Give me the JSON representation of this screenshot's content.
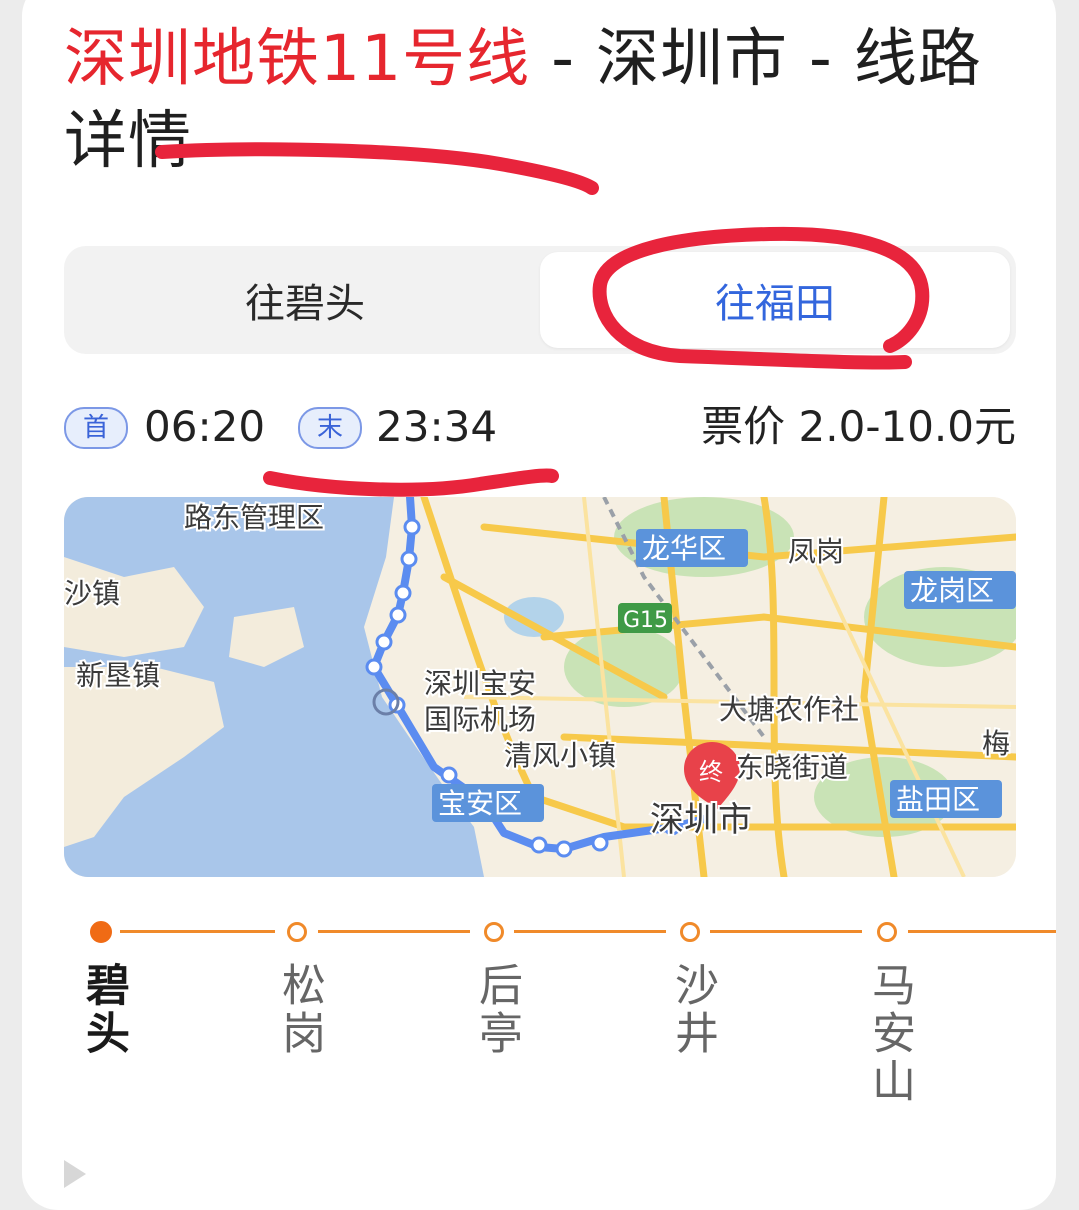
{
  "header": {
    "line_name": "深圳地铁11号线",
    "suffix": " - 深圳市 - 线路详情"
  },
  "direction_tabs": [
    {
      "label": "往碧头",
      "selected": false
    },
    {
      "label": "往福田",
      "selected": true
    }
  ],
  "schedule": {
    "first_badge": "首",
    "first_time": "06:20",
    "last_badge": "末",
    "last_time": "23:34",
    "fare": "票价 2.0-10.0元"
  },
  "map": {
    "labels": {
      "ludong": "路东管理区",
      "shazhen": "沙镇",
      "xinkenzhen": "新垦镇",
      "airport_1": "深圳宝安",
      "airport_2": "国际机场",
      "qingfeng": "清风小镇",
      "baoan": "宝安区",
      "shenzhen": "深圳市",
      "longhua": "龙华区",
      "fenggang": "凤岗",
      "longgang": "龙岗区",
      "g15": "G15",
      "datang": "大塘农作社",
      "dongxiao": "东晓街道",
      "yantian": "盐田区",
      "mei": "梅",
      "terminal": "终"
    },
    "colors": {
      "route": "#5b8cf0",
      "terminal": "#e8424a"
    }
  },
  "stations": [
    {
      "name": "碧头",
      "active": true
    },
    {
      "name": "松岗",
      "active": false
    },
    {
      "name": "后亭",
      "active": false
    },
    {
      "name": "沙井",
      "active": false
    },
    {
      "name": "马安山",
      "active": false
    }
  ],
  "colors": {
    "line_red": "#e6262e",
    "accent_blue": "#3366dd",
    "track_orange": "#f08a2a"
  }
}
